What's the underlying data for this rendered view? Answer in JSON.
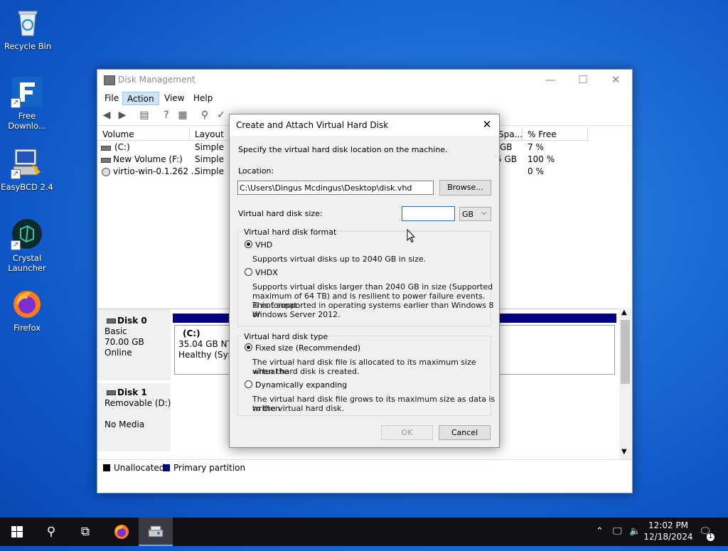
{
  "desktop": {
    "icons": [
      {
        "label": "Recycle Bin"
      },
      {
        "label": "Free\nDownlo..."
      },
      {
        "label": "EasyBCD 2.4"
      },
      {
        "label": "Crystal\nLauncher"
      },
      {
        "label": "Firefox"
      }
    ]
  },
  "window": {
    "title": "Disk Management",
    "menu": [
      "File",
      "Action",
      "View",
      "Help"
    ],
    "columns": [
      "Volume",
      "Layout",
      "Spa...",
      "% Free"
    ],
    "rows": [
      {
        "volume": "(C:)",
        "layout": "Simple",
        "space": "GB",
        "free": "7 %"
      },
      {
        "volume": "New Volume (F:)",
        "layout": "Simple",
        "space": "5 GB",
        "free": "100 %"
      },
      {
        "volume": "virtio-win-0.1.262 ...",
        "layout": "Simple",
        "space": "",
        "free": "0 %"
      }
    ],
    "disks": [
      {
        "name": "Disk 0",
        "type": "Basic",
        "size": "70.00 GB",
        "status": "Online",
        "partition": {
          "name": "(C:)",
          "detail": "35.04 GB NTFS",
          "health": "Healthy (Syste"
        }
      },
      {
        "name": "Disk 1",
        "type": "Removable (D:)",
        "size": "",
        "status": "No Media"
      }
    ],
    "legend": {
      "unallocated": "Unallocated",
      "primary": "Primary partition"
    }
  },
  "dialog": {
    "title": "Create and Attach Virtual Hard Disk",
    "instruction": "Specify the virtual hard disk location on the machine.",
    "location_label": "Location:",
    "location_value": "C:\\Users\\Dingus Mcdingus\\Desktop\\disk.vhd",
    "browse": "Browse...",
    "size_label": "Virtual hard disk size:",
    "size_value": "",
    "size_unit": "GB",
    "format_group": "Virtual hard disk format",
    "vhd_label": "VHD",
    "vhd_desc": "Supports virtual disks up to 2040 GB in size.",
    "vhdx_label": "VHDX",
    "vhdx_desc_1": "Supports virtual disks larger than 2040 GB in size (Supported",
    "vhdx_desc_2": "maximum of 64 TB) and is resilient to power failure events. This format",
    "vhdx_desc_3": "is not supported in operating systems earlier than Windows 8 or",
    "vhdx_desc_4": "Windows Server 2012.",
    "type_group": "Virtual hard disk type",
    "fixed_label": "Fixed size (Recommended)",
    "fixed_desc_1": "The virtual hard disk file is allocated to its maximum size when the",
    "fixed_desc_2": "virtual hard disk is created.",
    "dynamic_label": "Dynamically expanding",
    "dynamic_desc_1": "The virtual hard disk file grows to its maximum size as data is written",
    "dynamic_desc_2": "to the virtual hard disk.",
    "ok": "OK",
    "cancel": "Cancel"
  },
  "taskbar": {
    "time": "12:02 PM",
    "date": "12/18/2024",
    "notification_count": "1"
  },
  "colors": {
    "primary_partition": "#000080",
    "unallocated": "#000000",
    "accent": "#0078d7"
  }
}
